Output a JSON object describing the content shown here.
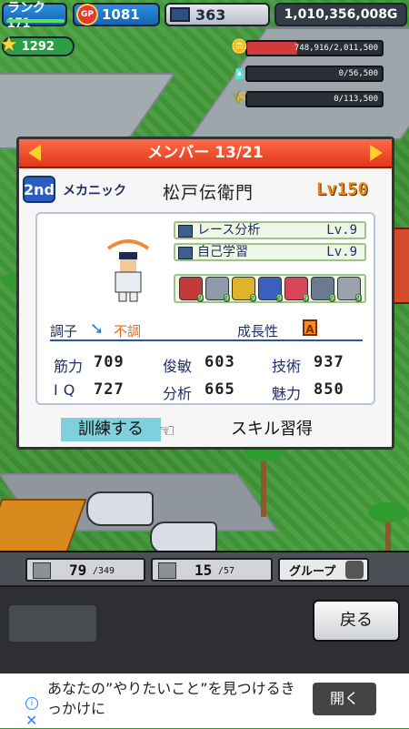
{
  "hud": {
    "rank_label": "ランク171",
    "gp_icon_label": "GP",
    "gp_value": "1081",
    "pc_value": "363",
    "money": "1,010,356,008G",
    "stars": "1292",
    "resources": [
      {
        "icon": "coin-stack-icon",
        "text": "748,916/2,011,500",
        "fill": 0.37,
        "color": "#d23b3b"
      },
      {
        "icon": "bottle-icon",
        "text": "0/56,500",
        "fill": 0,
        "color": "#d23b3b"
      },
      {
        "icon": "wheat-icon",
        "text": "0/113,500",
        "fill": 0,
        "color": "#d23b3b"
      }
    ]
  },
  "dialog": {
    "title": "メンバー 13/21",
    "grade": "2nd",
    "job": "メカニック",
    "name": "松戸伝衛門",
    "level": "Lv150",
    "skills": [
      {
        "name": "レース分析",
        "level": "Lv.9"
      },
      {
        "name": "自己学習",
        "level": "Lv.9"
      }
    ],
    "badge_levels": [
      "9",
      "9",
      "9",
      "9",
      "9",
      "9",
      "9"
    ],
    "condition_label": "調子",
    "condition_value": "不調",
    "growth_label": "成長性",
    "growth_grade": "A",
    "stats": [
      {
        "label": "筋力",
        "value": "709"
      },
      {
        "label": "俊敏",
        "value": "603"
      },
      {
        "label": "技術",
        "value": "937"
      },
      {
        "label": "IQ",
        "value": "727"
      },
      {
        "label": "分析",
        "value": "665"
      },
      {
        "label": "魅力",
        "value": "850"
      }
    ],
    "train_button": "訓練する",
    "skill_button": "スキル習得"
  },
  "bottom": {
    "tab1_value": "79",
    "tab1_max": "/349",
    "tab2_value": "15",
    "tab2_max": "/57",
    "group_label": "グループ",
    "back_button": "戻る"
  },
  "ad": {
    "text": "あなたの”やりたいこと”を見つけるきっかけに",
    "open_button": "開く",
    "info_icon": "i"
  },
  "colors": {
    "header_red": "#e0381a",
    "accent_blue": "#2a56a8",
    "condition_orange": "#e36a1e"
  }
}
